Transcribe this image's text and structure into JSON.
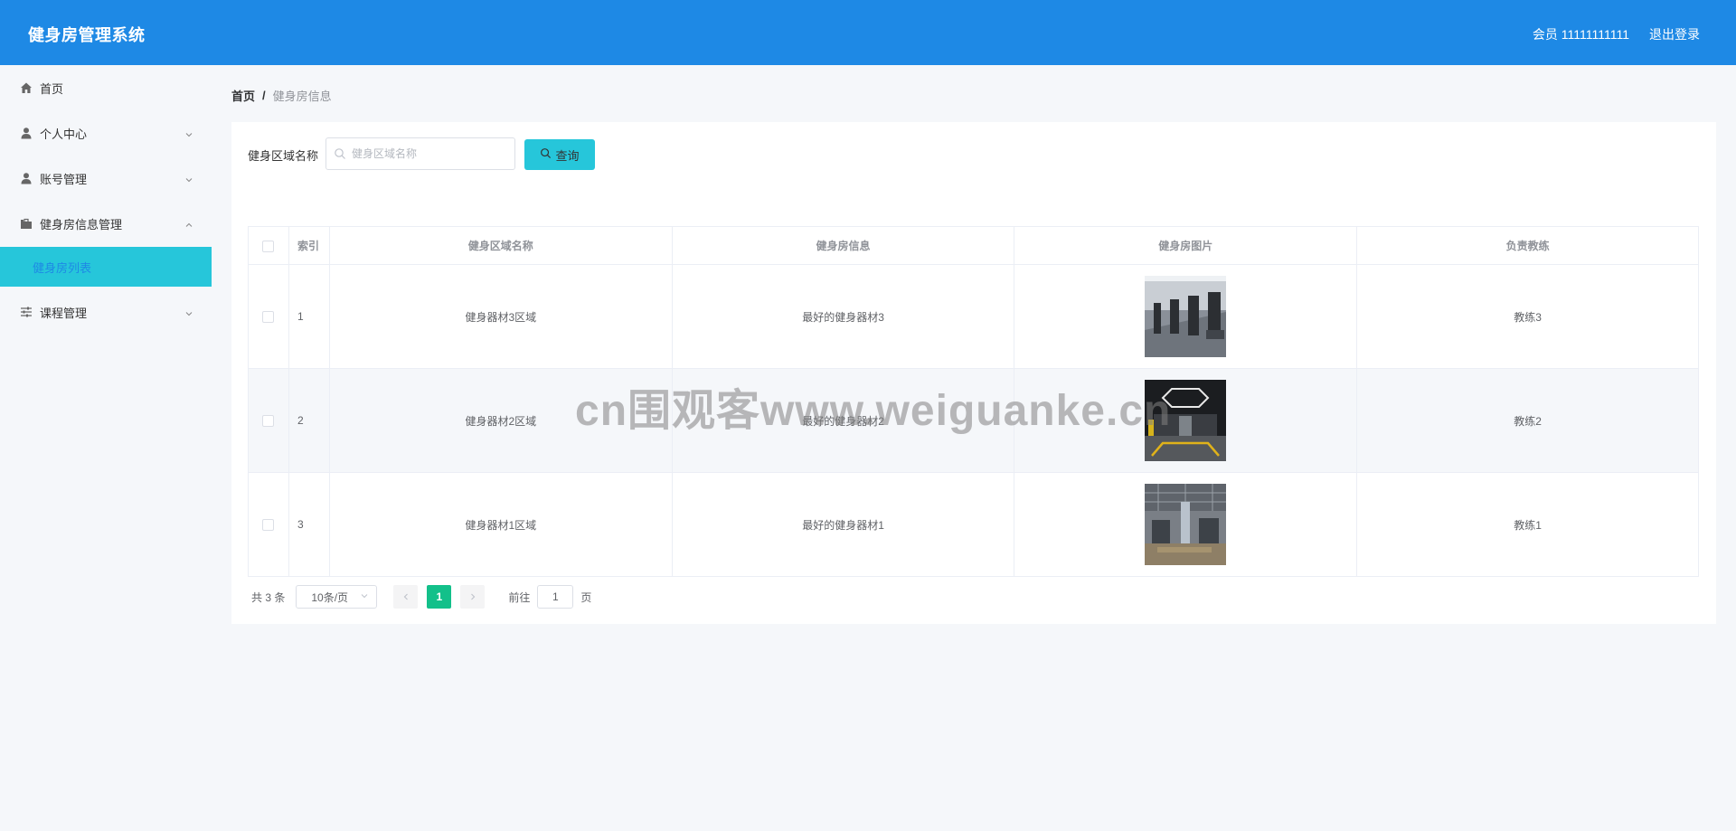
{
  "header": {
    "title": "健身房管理系统",
    "user_label": "会员 11111111111",
    "logout_label": "退出登录"
  },
  "sidebar": {
    "items": [
      {
        "label": "首页",
        "icon": "home-icon"
      },
      {
        "label": "个人中心",
        "icon": "user-icon"
      },
      {
        "label": "账号管理",
        "icon": "user-icon"
      },
      {
        "label": "健身房信息管理",
        "icon": "briefcase-icon"
      },
      {
        "label": "课程管理",
        "icon": "sliders-icon"
      }
    ],
    "active_sub_item": "健身房列表"
  },
  "breadcrumb": {
    "home": "首页",
    "separator": "/",
    "current": "健身房信息"
  },
  "search": {
    "label": "健身区域名称",
    "placeholder": "健身区域名称",
    "value": "",
    "button_label": "查询"
  },
  "table": {
    "headers": {
      "index": "索引",
      "area_name": "健身区域名称",
      "gym_info": "健身房信息",
      "gym_image": "健身房图片",
      "coach": "负责教练"
    },
    "rows": [
      {
        "index": "1",
        "area_name": "健身器材3区域",
        "gym_info": "最好的健身器材3",
        "coach": "教练3"
      },
      {
        "index": "2",
        "area_name": "健身器材2区域",
        "gym_info": "最好的健身器材2",
        "coach": "教练2"
      },
      {
        "index": "3",
        "area_name": "健身器材1区域",
        "gym_info": "最好的健身器材1",
        "coach": "教练1"
      }
    ]
  },
  "pagination": {
    "total_text": "共 3 条",
    "page_size": "10条/页",
    "current_page": "1",
    "goto_prefix": "前往",
    "goto_value": "1",
    "goto_suffix": "页"
  },
  "watermark": "cn围观客www.weiguanke.cn",
  "colors": {
    "header_bg": "#1e89e5",
    "accent_cyan": "#26c6da",
    "page_active": "#13c08a"
  }
}
